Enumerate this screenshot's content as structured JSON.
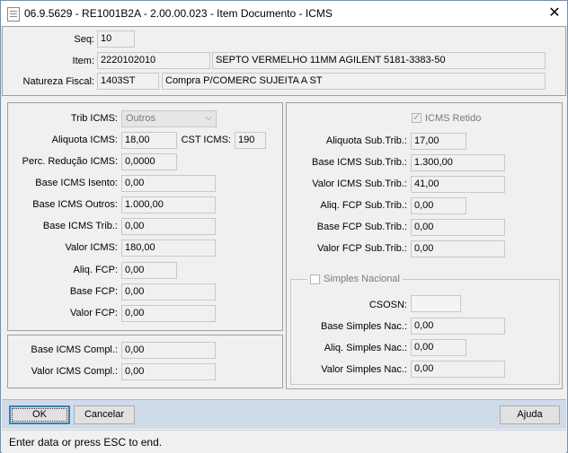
{
  "window": {
    "title": "06.9.5629 - RE1001B2A - 2.00.00.023 - Item Documento - ICMS",
    "close_glyph": "✕"
  },
  "header": {
    "seq_label": "Seq:",
    "seq_value": "10",
    "item_label": "Item:",
    "item_code": "2220102010",
    "item_desc": "SEPTO VERMELHO 11MM AGILENT 5181-3383-50",
    "natureza_label": "Natureza Fiscal:",
    "natureza_code": "1403ST",
    "natureza_desc": "Compra P/COMERC SUJEITA A ST"
  },
  "icms": {
    "trib_label": "Trib ICMS:",
    "trib_value": "Outros",
    "aliquota_label": "Aliquota ICMS:",
    "aliquota_value": "18,00",
    "cst_label": "CST ICMS:",
    "cst_value": "190",
    "perc_red_label": "Perc. Redução ICMS:",
    "perc_red_value": "0,0000",
    "base_isento_label": "Base ICMS Isento:",
    "base_isento_value": "0,00",
    "base_outros_label": "Base ICMS Outros:",
    "base_outros_value": "1.000,00",
    "base_trib_label": "Base ICMS Trib.:",
    "base_trib_value": "0,00",
    "valor_label": "Valor ICMS:",
    "valor_value": "180,00",
    "aliq_fcp_label": "Aliq. FCP:",
    "aliq_fcp_value": "0,00",
    "base_fcp_label": "Base FCP:",
    "base_fcp_value": "0,00",
    "valor_fcp_label": "Valor FCP:",
    "valor_fcp_value": "0,00"
  },
  "compl": {
    "base_label": "Base ICMS Compl.:",
    "base_value": "0,00",
    "valor_label": "Valor ICMS Compl.:",
    "valor_value": "0,00"
  },
  "st": {
    "retido_label": "ICMS Retido",
    "retido_checked": true,
    "aliquota_label": "Aliquota Sub.Trib.:",
    "aliquota_value": "17,00",
    "base_label": "Base ICMS Sub.Trib.:",
    "base_value": "1.300,00",
    "valor_label": "Valor ICMS Sub.Trib.:",
    "valor_value": "41,00",
    "aliq_fcp_label": "Aliq. FCP Sub.Trib.:",
    "aliq_fcp_value": "0,00",
    "base_fcp_label": "Base FCP Sub.Trib.:",
    "base_fcp_value": "0,00",
    "valor_fcp_label": "Valor FCP Sub.Trib.:",
    "valor_fcp_value": "0,00"
  },
  "simples": {
    "group_label": "Simples Nacional",
    "checked": false,
    "csosn_label": "CSOSN:",
    "csosn_value": "",
    "base_label": "Base Simples Nac.:",
    "base_value": "0,00",
    "aliq_label": "Aliq. Simples Nac.:",
    "aliq_value": "0,00",
    "valor_label": "Valor Simples Nac.:",
    "valor_value": "0,00"
  },
  "buttons": {
    "ok": "OK",
    "cancel": "Cancelar",
    "help": "Ajuda"
  },
  "status": {
    "text": "Enter data or press ESC to end."
  },
  "colors": {
    "button_bar": "#d0dbea",
    "default_button_border": "#3c7fb1"
  }
}
